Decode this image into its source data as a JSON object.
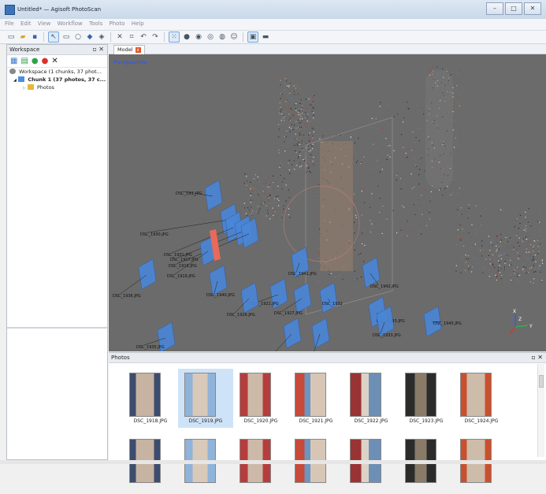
{
  "window": {
    "title": "Untitled* — Agisoft PhotoScan"
  },
  "menu": [
    "File",
    "Edit",
    "View",
    "Workflow",
    "Tools",
    "Photo",
    "Help"
  ],
  "workspace": {
    "title": "Workspace",
    "tree": [
      {
        "label": "Workspace (1 chunks, 37 phot..."
      },
      {
        "label": "Chunk 1 (37 photos, 37 c..."
      },
      {
        "label": "Photos"
      }
    ]
  },
  "model_tab": {
    "label": "Model"
  },
  "viewport": {
    "projection_label": "Perspective",
    "axis_labels": {
      "x": "X",
      "y": "Y",
      "z": "Z"
    },
    "camera_labels": [
      "DSC_193_JPG",
      "DSC_1930.JPG",
      "DSC_1931.JPG",
      "DSC_1917.JPG",
      "DSC_1918.JPG",
      "DSC_1919.JPG",
      "DSC_1936.JPG",
      "DSC_1941.JPG",
      "DSC_1942.JPG",
      "DSC_1940.JPG",
      "DSC_1921.JPG",
      "DSC_1926.JPG",
      "DSC_1927.JPG",
      "DSC_1932",
      "DSC_1943.JPG",
      "DSC_1933.JPG",
      "DSC_1945.JPG",
      "DSC_1935.JPG",
      "DSC_1934.JPG",
      "DSC_1938.JPG"
    ]
  },
  "photos": {
    "title": "Photos",
    "items": [
      {
        "name": "DSC_1918.JPG",
        "selected": false
      },
      {
        "name": "DSC_1919.JPG",
        "selected": true
      },
      {
        "name": "DSC_1920.JPG",
        "selected": false
      },
      {
        "name": "DSC_1921.JPG",
        "selected": false
      },
      {
        "name": "DSC_1922.JPG",
        "selected": false
      },
      {
        "name": "DSC_1923.JPG",
        "selected": false
      },
      {
        "name": "DSC_1924.JPG",
        "selected": false
      }
    ]
  }
}
